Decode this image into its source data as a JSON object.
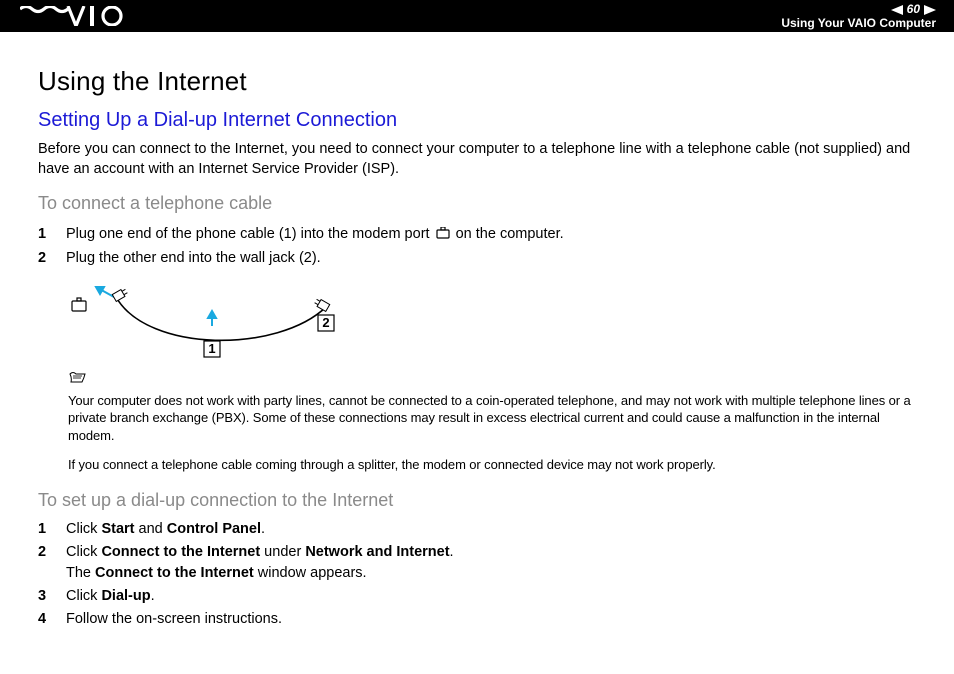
{
  "header": {
    "page_number": "60",
    "section": "Using Your VAIO Computer"
  },
  "h1": "Using the Internet",
  "h2": "Setting Up a Dial-up Internet Connection",
  "intro": "Before you can connect to the Internet, you need to connect your computer to a telephone line with a telephone cable (not supplied) and have an account with an Internet Service Provider (ISP).",
  "h3a": "To connect a telephone cable",
  "steps_a": [
    {
      "num": "1",
      "pre": "Plug one end of the phone cable (1) into the modem port ",
      "post": " on the computer."
    },
    {
      "num": "2",
      "pre": "Plug the other end into the wall jack (2).",
      "post": ""
    }
  ],
  "diagram": {
    "label1": "1",
    "label2": "2"
  },
  "note": {
    "p1": "Your computer does not work with party lines, cannot be connected to a coin-operated telephone, and may not work with multiple telephone lines or a private branch exchange (PBX). Some of these connections may result in excess electrical current and could cause a malfunction in the internal modem.",
    "p2": "If you connect a telephone cable coming through a splitter, the modem or connected device may not work properly."
  },
  "h3b": "To set up a dial-up connection to the Internet",
  "steps_b": [
    {
      "num": "1",
      "parts": [
        "Click ",
        "Start",
        " and ",
        "Control Panel",
        "."
      ]
    },
    {
      "num": "2",
      "parts": [
        "Click ",
        "Connect to the Internet",
        " under ",
        "Network and Internet",
        ".\nThe ",
        "Connect to the Internet",
        " window appears."
      ]
    },
    {
      "num": "3",
      "parts": [
        "Click ",
        "Dial-up",
        "."
      ]
    },
    {
      "num": "4",
      "parts": [
        "Follow the on-screen instructions."
      ]
    }
  ]
}
